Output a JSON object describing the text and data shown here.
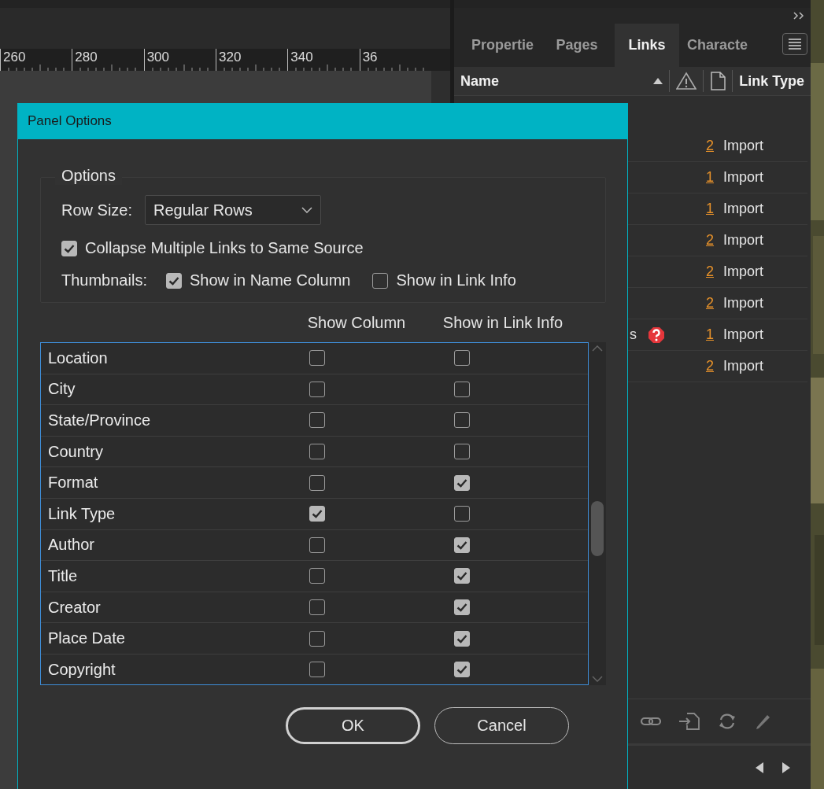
{
  "ruler": {
    "labels": [
      "260",
      "280",
      "300",
      "320",
      "340",
      "36"
    ]
  },
  "links_panel": {
    "tabs": [
      {
        "label": "Propertie",
        "selected": false
      },
      {
        "label": "Pages",
        "selected": false
      },
      {
        "label": "Links",
        "selected": true
      },
      {
        "label": "Characte",
        "selected": false
      }
    ],
    "columns": {
      "name": "Name",
      "link_type": "Link Type"
    },
    "rows": [
      {
        "count": "2",
        "link_type": "Import",
        "missing": false
      },
      {
        "count": "1",
        "link_type": "Import",
        "missing": false
      },
      {
        "count": "1",
        "link_type": "Import",
        "missing": false
      },
      {
        "count": "2",
        "link_type": "Import",
        "missing": false
      },
      {
        "count": "2",
        "link_type": "Import",
        "missing": false
      },
      {
        "count": "2",
        "link_type": "Import",
        "missing": false
      },
      {
        "name": "s",
        "count": "1",
        "link_type": "Import",
        "missing": true
      },
      {
        "count": "2",
        "link_type": "Import",
        "missing": false
      }
    ]
  },
  "dialog": {
    "title": "Panel Options",
    "group_title": "Options",
    "row_size": {
      "label": "Row Size:",
      "value": "Regular Rows"
    },
    "collapse": {
      "label": "Collapse Multiple Links to Same Source",
      "checked": true
    },
    "thumbnails": {
      "label": "Thumbnails:",
      "options": [
        {
          "label": "Show in Name Column",
          "checked": true
        },
        {
          "label": "Show in Link Info",
          "checked": false
        }
      ]
    },
    "list_headers": {
      "show_column": "Show Column",
      "show_in_link_info": "Show in Link Info"
    },
    "rows": [
      {
        "name": "Location",
        "show_column": false,
        "show_in_link_info": false
      },
      {
        "name": "City",
        "show_column": false,
        "show_in_link_info": false
      },
      {
        "name": "State/Province",
        "show_column": false,
        "show_in_link_info": false
      },
      {
        "name": "Country",
        "show_column": false,
        "show_in_link_info": false
      },
      {
        "name": "Format",
        "show_column": false,
        "show_in_link_info": true
      },
      {
        "name": "Link Type",
        "show_column": true,
        "show_in_link_info": false
      },
      {
        "name": "Author",
        "show_column": false,
        "show_in_link_info": true
      },
      {
        "name": "Title",
        "show_column": false,
        "show_in_link_info": true
      },
      {
        "name": "Creator",
        "show_column": false,
        "show_in_link_info": true
      },
      {
        "name": "Place Date",
        "show_column": false,
        "show_in_link_info": true
      },
      {
        "name": "Copyright",
        "show_column": false,
        "show_in_link_info": true
      }
    ],
    "buttons": [
      {
        "label": "OK",
        "kind": "default"
      },
      {
        "label": "Cancel",
        "kind": "normal"
      }
    ]
  }
}
